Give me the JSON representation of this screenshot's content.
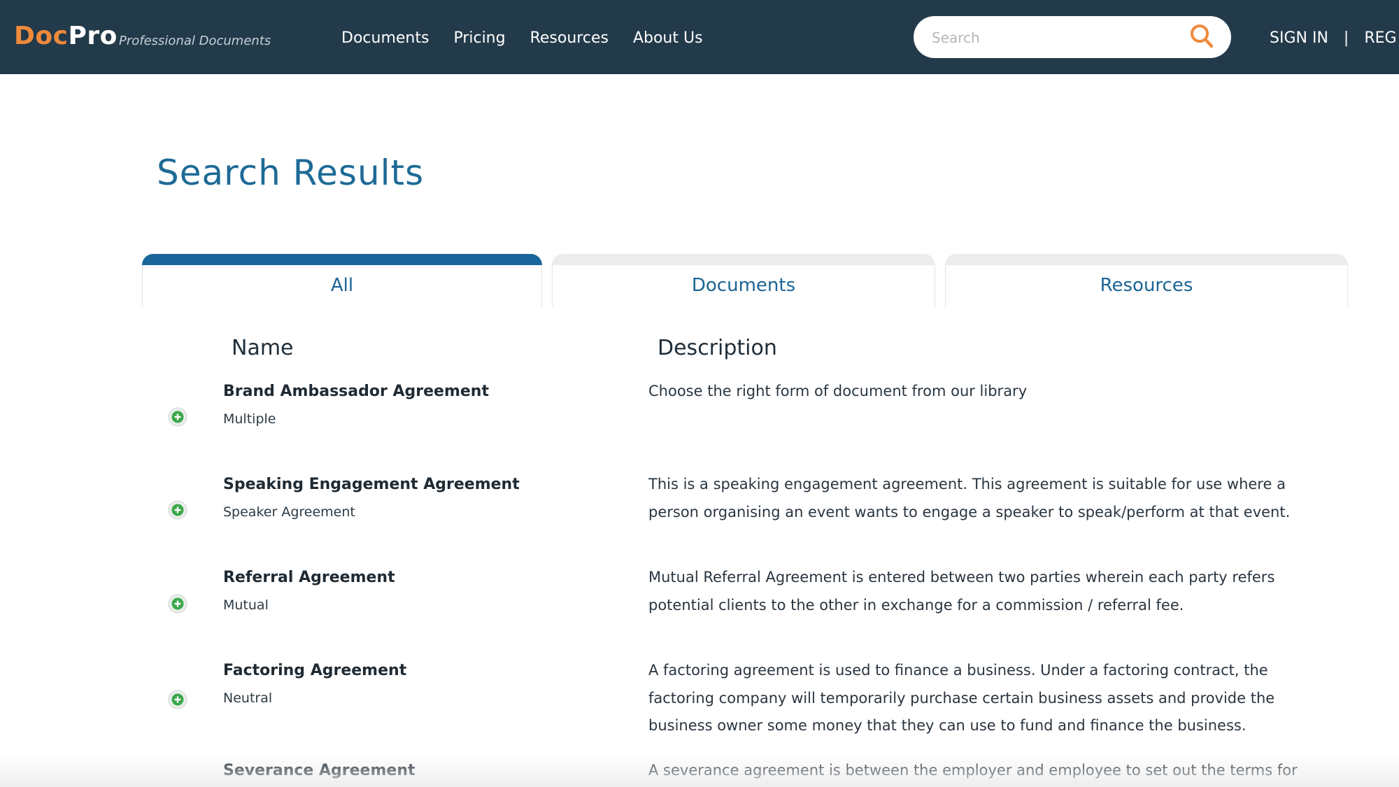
{
  "header": {
    "logo_part1": "Doc",
    "logo_part2": "Pro",
    "tagline": "Professional Documents",
    "nav": [
      "Documents",
      "Pricing",
      "Resources",
      "About Us"
    ],
    "search_placeholder": "Search",
    "sign_in": "SIGN IN",
    "separator": "|",
    "register_partial": "REG"
  },
  "colors": {
    "header_bg": "#233a4a",
    "logo_accent": "#ef8a3c",
    "title_blue": "#1e6a96",
    "tab_active": "#1a659a",
    "add_icon_green": "#3aa84a"
  },
  "page": {
    "title": "Search Results"
  },
  "tabs": [
    {
      "label": "All",
      "active": true
    },
    {
      "label": "Documents",
      "active": false
    },
    {
      "label": "Resources",
      "active": false
    }
  ],
  "table": {
    "headers": {
      "name": "Name",
      "description": "Description"
    },
    "rows": [
      {
        "name": "Brand Ambassador Agreement",
        "sub": "Multiple",
        "description": "Choose the right form of document from our library",
        "icon": "add-circle-icon"
      },
      {
        "name": "Speaking Engagement Agreement",
        "sub": "Speaker Agreement",
        "description": "This is a speaking engagement agreement. This agreement is suitable for use where a person organising an event wants to engage a speaker to speak/perform at that event.",
        "icon": "add-circle-icon"
      },
      {
        "name": "Referral Agreement",
        "sub": "Mutual",
        "description": "Mutual Referral Agreement is entered between two parties wherein each party refers potential clients to the other in exchange for a commission / referral fee.",
        "icon": "add-circle-icon"
      },
      {
        "name": "Factoring Agreement",
        "sub": "Neutral",
        "description": "A factoring agreement is used to finance a business. Under a factoring contract, the factoring company will temporarily purchase certain business assets and provide the business owner some money that they can use to fund and finance the business.",
        "icon": "add-circle-icon"
      },
      {
        "name": "Severance Agreement",
        "sub": "",
        "description": "A severance agreement is between the employer and employee to set out the terms for",
        "icon": "add-circle-icon"
      }
    ]
  }
}
